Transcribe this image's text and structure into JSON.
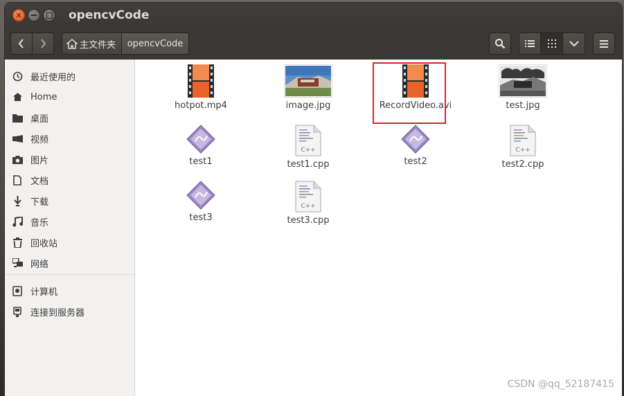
{
  "window": {
    "title": "opencvCode"
  },
  "toolbar": {
    "breadcrumb_home": "主文件夹",
    "breadcrumb_current": "opencvCode"
  },
  "sidebar": {
    "items": [
      {
        "label": "最近使用的",
        "icon": "clock-icon"
      },
      {
        "label": "Home",
        "icon": "home-icon"
      },
      {
        "label": "桌面",
        "icon": "folder-icon"
      },
      {
        "label": "视频",
        "icon": "video-icon"
      },
      {
        "label": "图片",
        "icon": "camera-icon"
      },
      {
        "label": "文档",
        "icon": "document-icon"
      },
      {
        "label": "下载",
        "icon": "download-icon"
      },
      {
        "label": "音乐",
        "icon": "music-icon"
      },
      {
        "label": "回收站",
        "icon": "trash-icon"
      },
      {
        "label": "网络",
        "icon": "network-icon"
      }
    ],
    "devices": [
      {
        "label": "计算机",
        "icon": "computer-icon"
      },
      {
        "label": "连接到服务器",
        "icon": "server-icon"
      }
    ]
  },
  "files": [
    {
      "name": "hotpot.mp4",
      "type": "video"
    },
    {
      "name": "image.jpg",
      "type": "image"
    },
    {
      "name": "RecordVideo.avi",
      "type": "video"
    },
    {
      "name": "test.jpg",
      "type": "image-bw"
    },
    {
      "name": "test1",
      "type": "executable"
    },
    {
      "name": "test1.cpp",
      "type": "cpp"
    },
    {
      "name": "test2",
      "type": "executable"
    },
    {
      "name": "test2.cpp",
      "type": "cpp"
    },
    {
      "name": "test3",
      "type": "executable"
    },
    {
      "name": "test3.cpp",
      "type": "cpp"
    }
  ],
  "watermark": "CSDN @qq_52187415",
  "colors": {
    "accent_close": "#e2541d",
    "highlight": "#e0202a",
    "film": "#e8632a"
  }
}
